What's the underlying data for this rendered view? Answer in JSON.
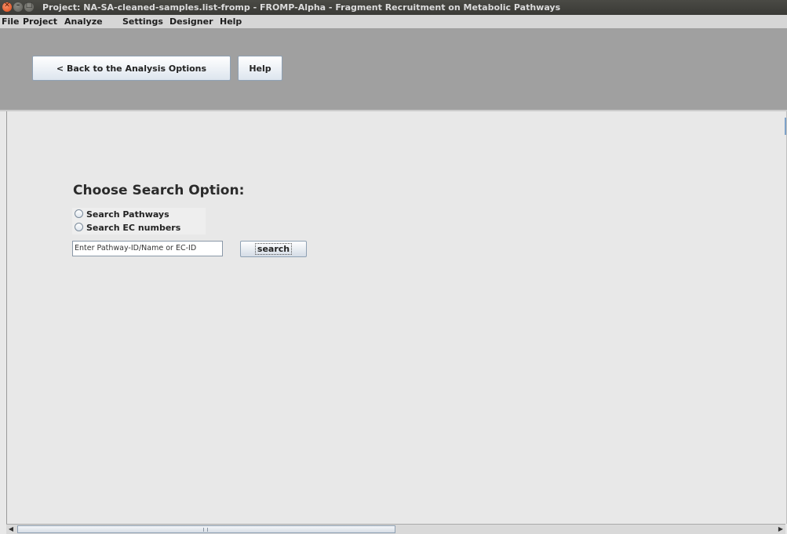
{
  "window": {
    "title": "Project: NA-SA-cleaned-samples.list-fromp - FROMP-Alpha - Fragment Recruitment on Metabolic Pathways"
  },
  "menu": [
    "File",
    "Project",
    "Analyze",
    "Settings",
    "Designer",
    "Help"
  ],
  "toolbar": {
    "back_label": "< Back to the Analysis Options",
    "help_label": "Help"
  },
  "search": {
    "heading": "Choose Search Option:",
    "options": [
      "Search Pathways",
      "Search EC numbers"
    ],
    "input_value": "Enter Pathway-ID/Name or EC-ID",
    "button_label": "search"
  },
  "colors": {
    "top_panel": "#a0a0a0",
    "content_bg": "#e8e8e8",
    "close_button": "#df4a16"
  }
}
